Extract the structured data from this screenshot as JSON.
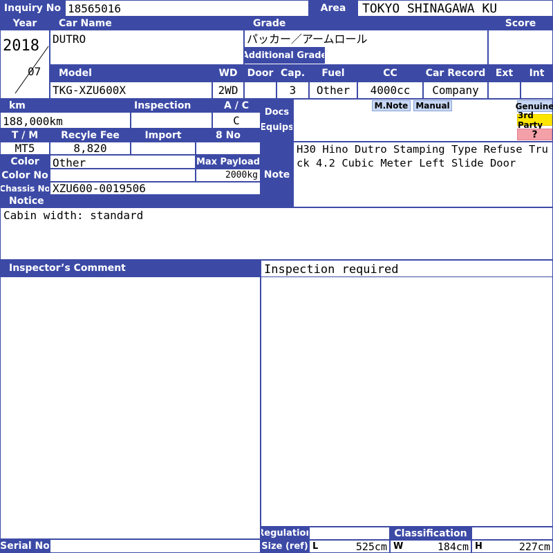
{
  "colors": {
    "header_bg": "#3c4aa6",
    "tag_bg": "#c8d8f4",
    "third_party_bg": "#ffe600",
    "unknown_bg": "#f4a0a8"
  },
  "inquiry": {
    "label": "Inquiry No",
    "value": "18565016"
  },
  "area": {
    "label": "Area",
    "value": "TOKYO SHINAGAWA KU"
  },
  "year": {
    "label": "Year",
    "value": "2018",
    "month": "07"
  },
  "car_name": {
    "label": "Car Name",
    "value": "DUTRO"
  },
  "grade": {
    "label": "Grade",
    "value": "パッカー／アームロール",
    "additional_label": "Additional Grade",
    "additional_value": ""
  },
  "score": {
    "label": "Score",
    "value": ""
  },
  "model": {
    "label": "Model",
    "value": "TKG-XZU600X"
  },
  "wd": {
    "label": "WD",
    "value": "2WD"
  },
  "door": {
    "label": "Door",
    "value": ""
  },
  "cap": {
    "label": "Cap.",
    "value": "3"
  },
  "fuel": {
    "label": "Fuel",
    "value": "Other"
  },
  "cc": {
    "label": "CC",
    "value": "4000cc"
  },
  "car_record": {
    "label": "Car Record",
    "value": "Company"
  },
  "ext": {
    "label": "Ext",
    "value": ""
  },
  "int": {
    "label": "Int",
    "value": ""
  },
  "km": {
    "label": "km",
    "value": "188,000km"
  },
  "inspection": {
    "label": "Inspection",
    "value": ""
  },
  "ac": {
    "label": "A / C",
    "value": "C"
  },
  "docs_equips": {
    "label_line1": "Docs",
    "label_line2": "Equips",
    "mnote": "M.Note",
    "manual": "Manual"
  },
  "parts_tags": {
    "genuine": "Genuine",
    "third_party": "3rd Party",
    "unknown": "?"
  },
  "tm": {
    "label": "T / M",
    "value": "MT5"
  },
  "recycle_fee": {
    "label": "Recyle Fee",
    "value": "8,820"
  },
  "import": {
    "label": "Import",
    "value": ""
  },
  "eight_no": {
    "label": "8 No",
    "value": ""
  },
  "color": {
    "label": "Color",
    "value": "Other"
  },
  "max_payload": {
    "label": "Max Payload",
    "value": "2000kg"
  },
  "color_no": {
    "label": "Color No",
    "value": ""
  },
  "chassis_no": {
    "label": "Chassis No",
    "value": "XZU600-0019506"
  },
  "note": {
    "label": "Note",
    "value": "H30 Hino Dutro Stamping Type Refuse Truck 4.2 Cubic Meter Left Slide Door"
  },
  "notice": {
    "label": "Notice",
    "value": "Cabin width: standard"
  },
  "inspector_comment": {
    "label": "Inspector’s Comment",
    "value": "Inspection required"
  },
  "serial_no": {
    "label": "Serial No",
    "value": ""
  },
  "regulation": {
    "label": "Regulation",
    "value": ""
  },
  "classification": {
    "label": "Classification",
    "value": ""
  },
  "size": {
    "label": "Size (ref)",
    "l_label": "L",
    "l_value": "525cm",
    "w_label": "W",
    "w_value": "184cm",
    "h_label": "H",
    "h_value": "227cm"
  }
}
